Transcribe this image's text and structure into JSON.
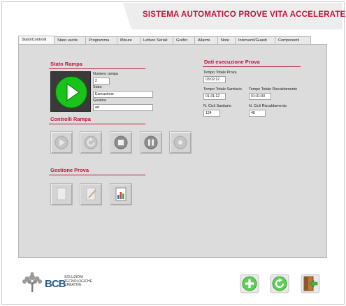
{
  "app": {
    "title": "SISTEMA AUTOMATICO PROVE VITA ACCELERATE"
  },
  "tabs": [
    {
      "label": "Stato/Controlli",
      "active": true
    },
    {
      "label": "Stato uscite"
    },
    {
      "label": "Programma"
    },
    {
      "label": "Misure"
    },
    {
      "label": "Letture Seriali"
    },
    {
      "label": "Grafici"
    },
    {
      "label": "Allarmi"
    },
    {
      "label": "Note"
    },
    {
      "label": "Interventi/Guasti"
    },
    {
      "label": "Componenti"
    }
  ],
  "stato_rampa": {
    "title": "Stato Rampa",
    "numero_rampa_label": "Numero rampa",
    "numero_rampa_value": "2",
    "stato_label": "Stato",
    "stato_value": "Esecuzione",
    "gestore_label": "Gestore",
    "gestore_value": "ad"
  },
  "controlli_rampa": {
    "title": "Controlli Rampa",
    "buttons": [
      "play-icon",
      "reset-icon",
      "stop-icon",
      "pause-icon",
      "record-icon"
    ]
  },
  "gestione_prova": {
    "title": "Gestione Prova",
    "buttons": [
      "document-icon",
      "edit-icon",
      "report-chart-icon"
    ]
  },
  "dati_esecuzione": {
    "title": "Dati esecuzione Prova",
    "tempo_totale_prova_label": "Tempo Totale Prova",
    "tempo_totale_prova_value": "03:02:12",
    "tempo_totale_sanitario_label": "Tempo Totale Sanitario",
    "tempo_totale_sanitario_value": "01:31:12",
    "tempo_totale_riscaldamento_label": "Tempo Totale Riscaldamento",
    "tempo_totale_riscaldamento_value": "01:31:00",
    "cicli_sanitario_label": "N. Cicli Sanitario",
    "cicli_sanitario_value": "124",
    "cicli_riscaldamento_label": "N. Cicli Riscaldamento",
    "cicli_riscaldamento_value": "48"
  },
  "logo": {
    "mark": "BCB",
    "line1": "SOLUZIONI",
    "line2": "TECNOLOGICHE",
    "line3": "CREATIVE"
  },
  "bottom_buttons": [
    "add-icon",
    "refresh-icon",
    "exit-icon"
  ],
  "colors": {
    "accent": "#c0143c",
    "status_green": "#19c319",
    "panel_bg": "#dcdcdc"
  }
}
